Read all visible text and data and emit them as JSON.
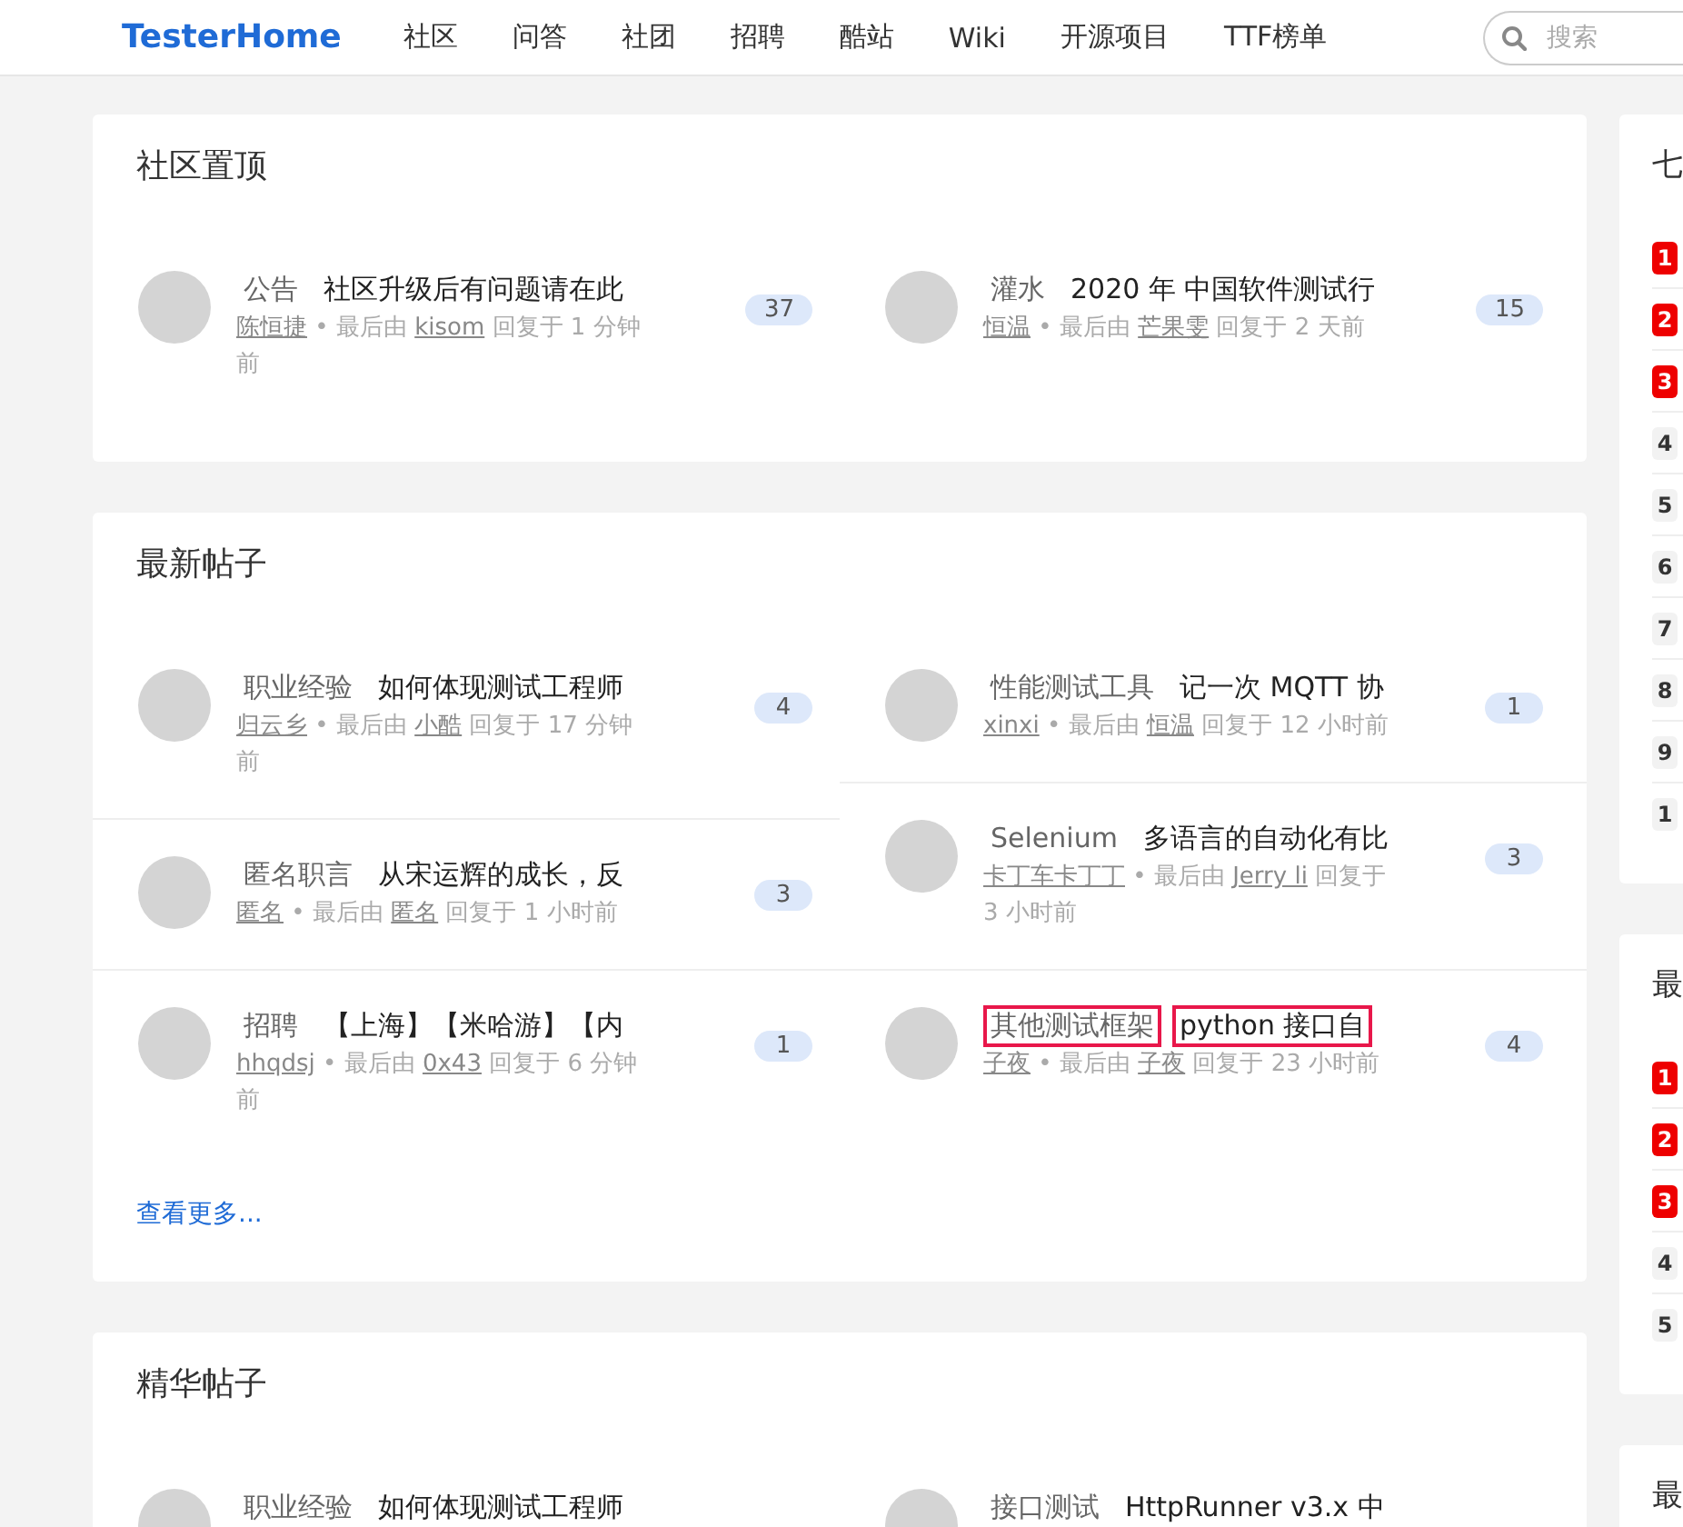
{
  "navbar": {
    "logo": "TesterHome",
    "items": [
      "社区",
      "问答",
      "社团",
      "招聘",
      "酷站",
      "Wiki",
      "开源项目",
      "TTF榜单"
    ],
    "search": {
      "placeholder": "搜索"
    }
  },
  "sections": [
    {
      "title": "社区置顶",
      "columns": [
        [
          {
            "node": "公告",
            "title": "社区升级后有问题请在此",
            "count": "37",
            "highlighted": false,
            "meta": [
              {
                "text": "陈恒捷",
                "link": true
              },
              {
                "text": "• 最后由",
                "link": false
              },
              {
                "text": "kisom",
                "link": true
              },
              {
                "text": "回复于 1 分钟前",
                "link": false
              }
            ]
          }
        ],
        [
          {
            "node": "灌水",
            "title": "2020 年 中国软件测试行",
            "count": "15",
            "highlighted": false,
            "meta": [
              {
                "text": "恒温",
                "link": true
              },
              {
                "text": "• 最后由",
                "link": false
              },
              {
                "text": "芒果雯",
                "link": true
              },
              {
                "text": "回复于 2 天前",
                "link": false
              }
            ]
          }
        ]
      ]
    },
    {
      "title": "最新帖子",
      "more": "查看更多...",
      "columns": [
        [
          {
            "node": "职业经验",
            "title": "如何体现测试工程师",
            "count": "4",
            "highlighted": false,
            "meta": [
              {
                "text": "归云乡",
                "link": true
              },
              {
                "text": "• 最后由",
                "link": false
              },
              {
                "text": "小酷",
                "link": true
              },
              {
                "text": "回复于 17 分钟前",
                "link": false
              }
            ]
          },
          {
            "node": "匿名职言",
            "title": "从宋运辉的成长，反",
            "count": "3",
            "highlighted": false,
            "meta": [
              {
                "text": "匿名",
                "link": true
              },
              {
                "text": "• 最后由",
                "link": false
              },
              {
                "text": "匿名",
                "link": true
              },
              {
                "text": "回复于 1 小时前",
                "link": false
              }
            ]
          },
          {
            "node": "招聘",
            "title": "【上海】【米哈游】【内",
            "count": "1",
            "highlighted": false,
            "meta": [
              {
                "text": "hhqdsj",
                "link": true
              },
              {
                "text": "• 最后由",
                "link": false
              },
              {
                "text": "0x43",
                "link": true
              },
              {
                "text": "回复于 6 分钟前",
                "link": false
              }
            ]
          }
        ],
        [
          {
            "node": "性能测试工具",
            "title": "记一次 MQTT 协",
            "count": "1",
            "highlighted": false,
            "meta": [
              {
                "text": "xinxi",
                "link": true
              },
              {
                "text": "• 最后由",
                "link": false
              },
              {
                "text": "恒温",
                "link": true
              },
              {
                "text": "回复于 12 小时前",
                "link": false
              }
            ]
          },
          {
            "node": "Selenium",
            "title": "多语言的自动化有比",
            "count": "3",
            "highlighted": false,
            "meta": [
              {
                "text": "卡丁车卡丁丁",
                "link": true
              },
              {
                "text": "• 最后由",
                "link": false
              },
              {
                "text": "Jerry li",
                "link": true
              },
              {
                "text": "回复于 3 小时前",
                "link": false
              }
            ]
          },
          {
            "node": "其他测试框架",
            "title": "python 接口自",
            "count": "4",
            "highlighted": true,
            "meta": [
              {
                "text": "子夜",
                "link": true
              },
              {
                "text": "• 最后由",
                "link": false
              },
              {
                "text": "子夜",
                "link": true
              },
              {
                "text": "回复于 23 小时前",
                "link": false
              }
            ]
          }
        ]
      ]
    },
    {
      "title": "精华帖子",
      "columns": [
        [
          {
            "node": "职业经验",
            "title": "如何体现测试工程师",
            "highlighted": false
          }
        ],
        [
          {
            "node": "接口测试",
            "title": "HttpRunner v3.x 中",
            "highlighted": false
          }
        ]
      ]
    }
  ],
  "sidebar": [
    {
      "title": "七",
      "ranks": [
        {
          "label": "1",
          "top": true
        },
        {
          "label": "2",
          "top": true
        },
        {
          "label": "3",
          "top": true
        },
        {
          "label": "4",
          "top": false
        },
        {
          "label": "5",
          "top": false
        },
        {
          "label": "6",
          "top": false
        },
        {
          "label": "7",
          "top": false
        },
        {
          "label": "8",
          "top": false
        },
        {
          "label": "9",
          "top": false
        },
        {
          "label": "1",
          "top": false
        }
      ]
    },
    {
      "title": "最",
      "ranks": [
        {
          "label": "1",
          "top": true
        },
        {
          "label": "2",
          "top": true
        },
        {
          "label": "3",
          "top": true
        },
        {
          "label": "4",
          "top": false
        },
        {
          "label": "5",
          "top": false
        }
      ]
    },
    {
      "title": "最"
    }
  ]
}
